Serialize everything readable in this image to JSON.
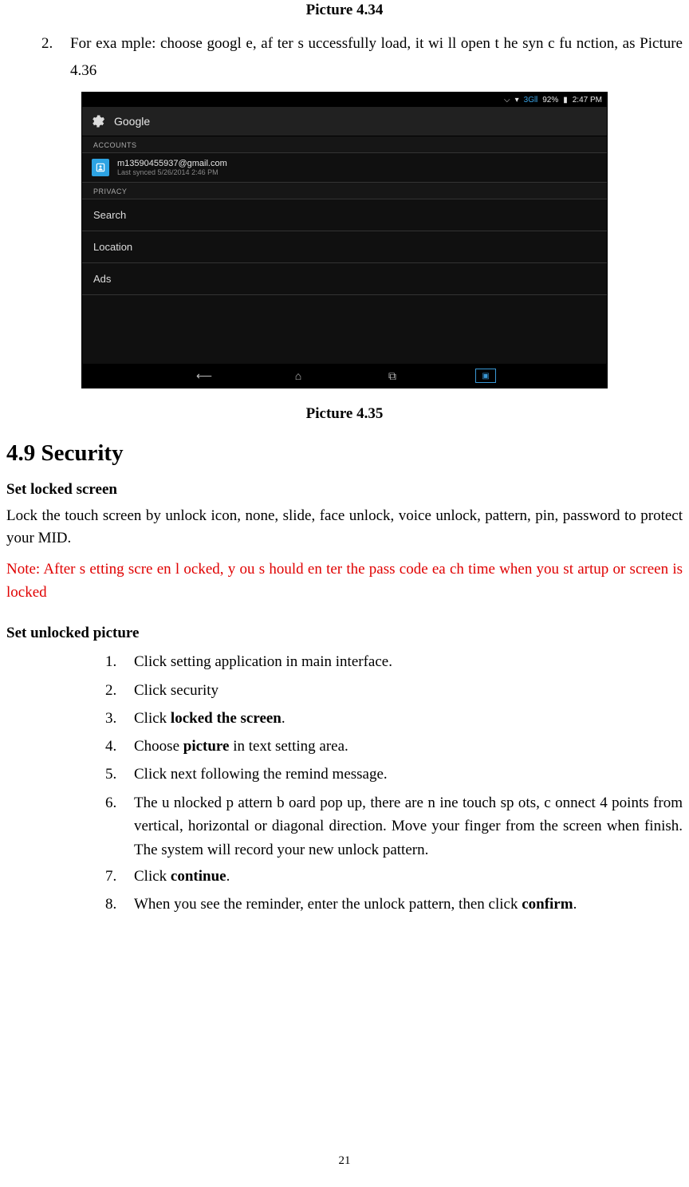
{
  "captions": {
    "top": "Picture 4.34",
    "mid": "Picture 4.35"
  },
  "intro_list_start": "2.",
  "intro_text": "For exa mple: choose googl e, af ter s uccessfully load, it wi ll open t he syn c fu nction, as Picture 4.36",
  "screenshot": {
    "status": {
      "bt": "⌵",
      "wifi": "▾",
      "signal": "3G⫴",
      "batt_pct": "92%",
      "batt": "▮",
      "time": "2:47 PM"
    },
    "title": "Google",
    "accounts_label": "ACCOUNTS",
    "account_email": "m13590455937@gmail.com",
    "account_sub": "Last synced 5/26/2014 2:46 PM",
    "privacy_label": "PRIVACY",
    "rows": {
      "r1": "Search",
      "r2": "Location",
      "r3": "Ads"
    }
  },
  "heading": "4.9 Security",
  "sub1": "Set locked screen",
  "para1": "Lock the touch screen by unlock icon, none, slide, face unlock, voice unlock, pattern, pin, password to protect your MID.",
  "note": "Note: After s etting scre en l ocked, y ou s hould en ter the pass code ea ch time when  you st artup or screen is locked",
  "sub2": "Set unlocked picture",
  "steps": {
    "n1": "1.",
    "t1": "Click setting application in main interface.",
    "n2": "2.",
    "t2": "Click security",
    "n3": "3.",
    "t3a": "Click ",
    "t3b": "locked the screen",
    "t3c": ".",
    "n4": "4.",
    "t4a": "Choose ",
    "t4b": "picture",
    "t4c": " in text setting area.",
    "n5": "5.",
    "t5": "Click next following the remind message.",
    "n6": "6.",
    "t6": "The u nlocked p attern b oard pop up, there are n ine touch sp ots, c onnect 4 points from vertical, horizontal or diagonal direction. Move your finger from the screen when finish. The system will record your new unlock pattern.",
    "n7": "7.",
    "t7a": "Click ",
    "t7b": "continue",
    "t7c": ".",
    "n8": "8.",
    "t8a": "When you see the reminder, enter the unlock pattern, then click ",
    "t8b": "confirm",
    "t8c": "."
  },
  "page_number": "21"
}
